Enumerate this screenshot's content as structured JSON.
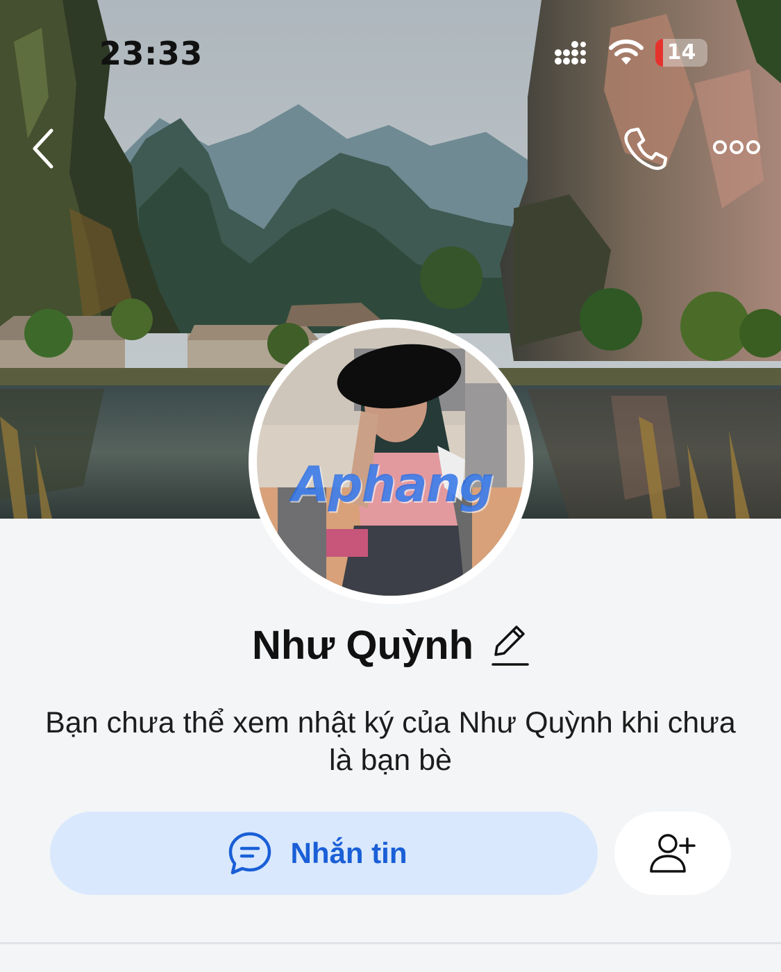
{
  "status_bar": {
    "time": "23:33",
    "battery_level": "14",
    "battery_fraction": 0.14,
    "signal_icon": "cellular-signal-icon",
    "wifi_icon": "wifi-icon"
  },
  "nav": {
    "back_icon": "chevron-left-icon",
    "call_icon": "phone-icon",
    "more_icon": "more-horizontal-icon"
  },
  "cover": {
    "description_icon": "cover-photo"
  },
  "avatar": {
    "watermark_text": "Aphang"
  },
  "profile": {
    "name": "Như Quỳnh",
    "edit_icon": "pencil-icon",
    "privacy_note": "Bạn chưa thể xem nhật ký của Như Quỳnh khi chưa là bạn bè"
  },
  "actions": {
    "message_label": "Nhắn tin",
    "message_icon": "chat-bubble-icon",
    "add_friend_icon": "add-friend-icon"
  },
  "colors": {
    "accent": "#1a5fd6",
    "message_button_bg": "#d9e8fd",
    "page_bg": "#f3f5f7",
    "battery_low": "#e5322d"
  }
}
